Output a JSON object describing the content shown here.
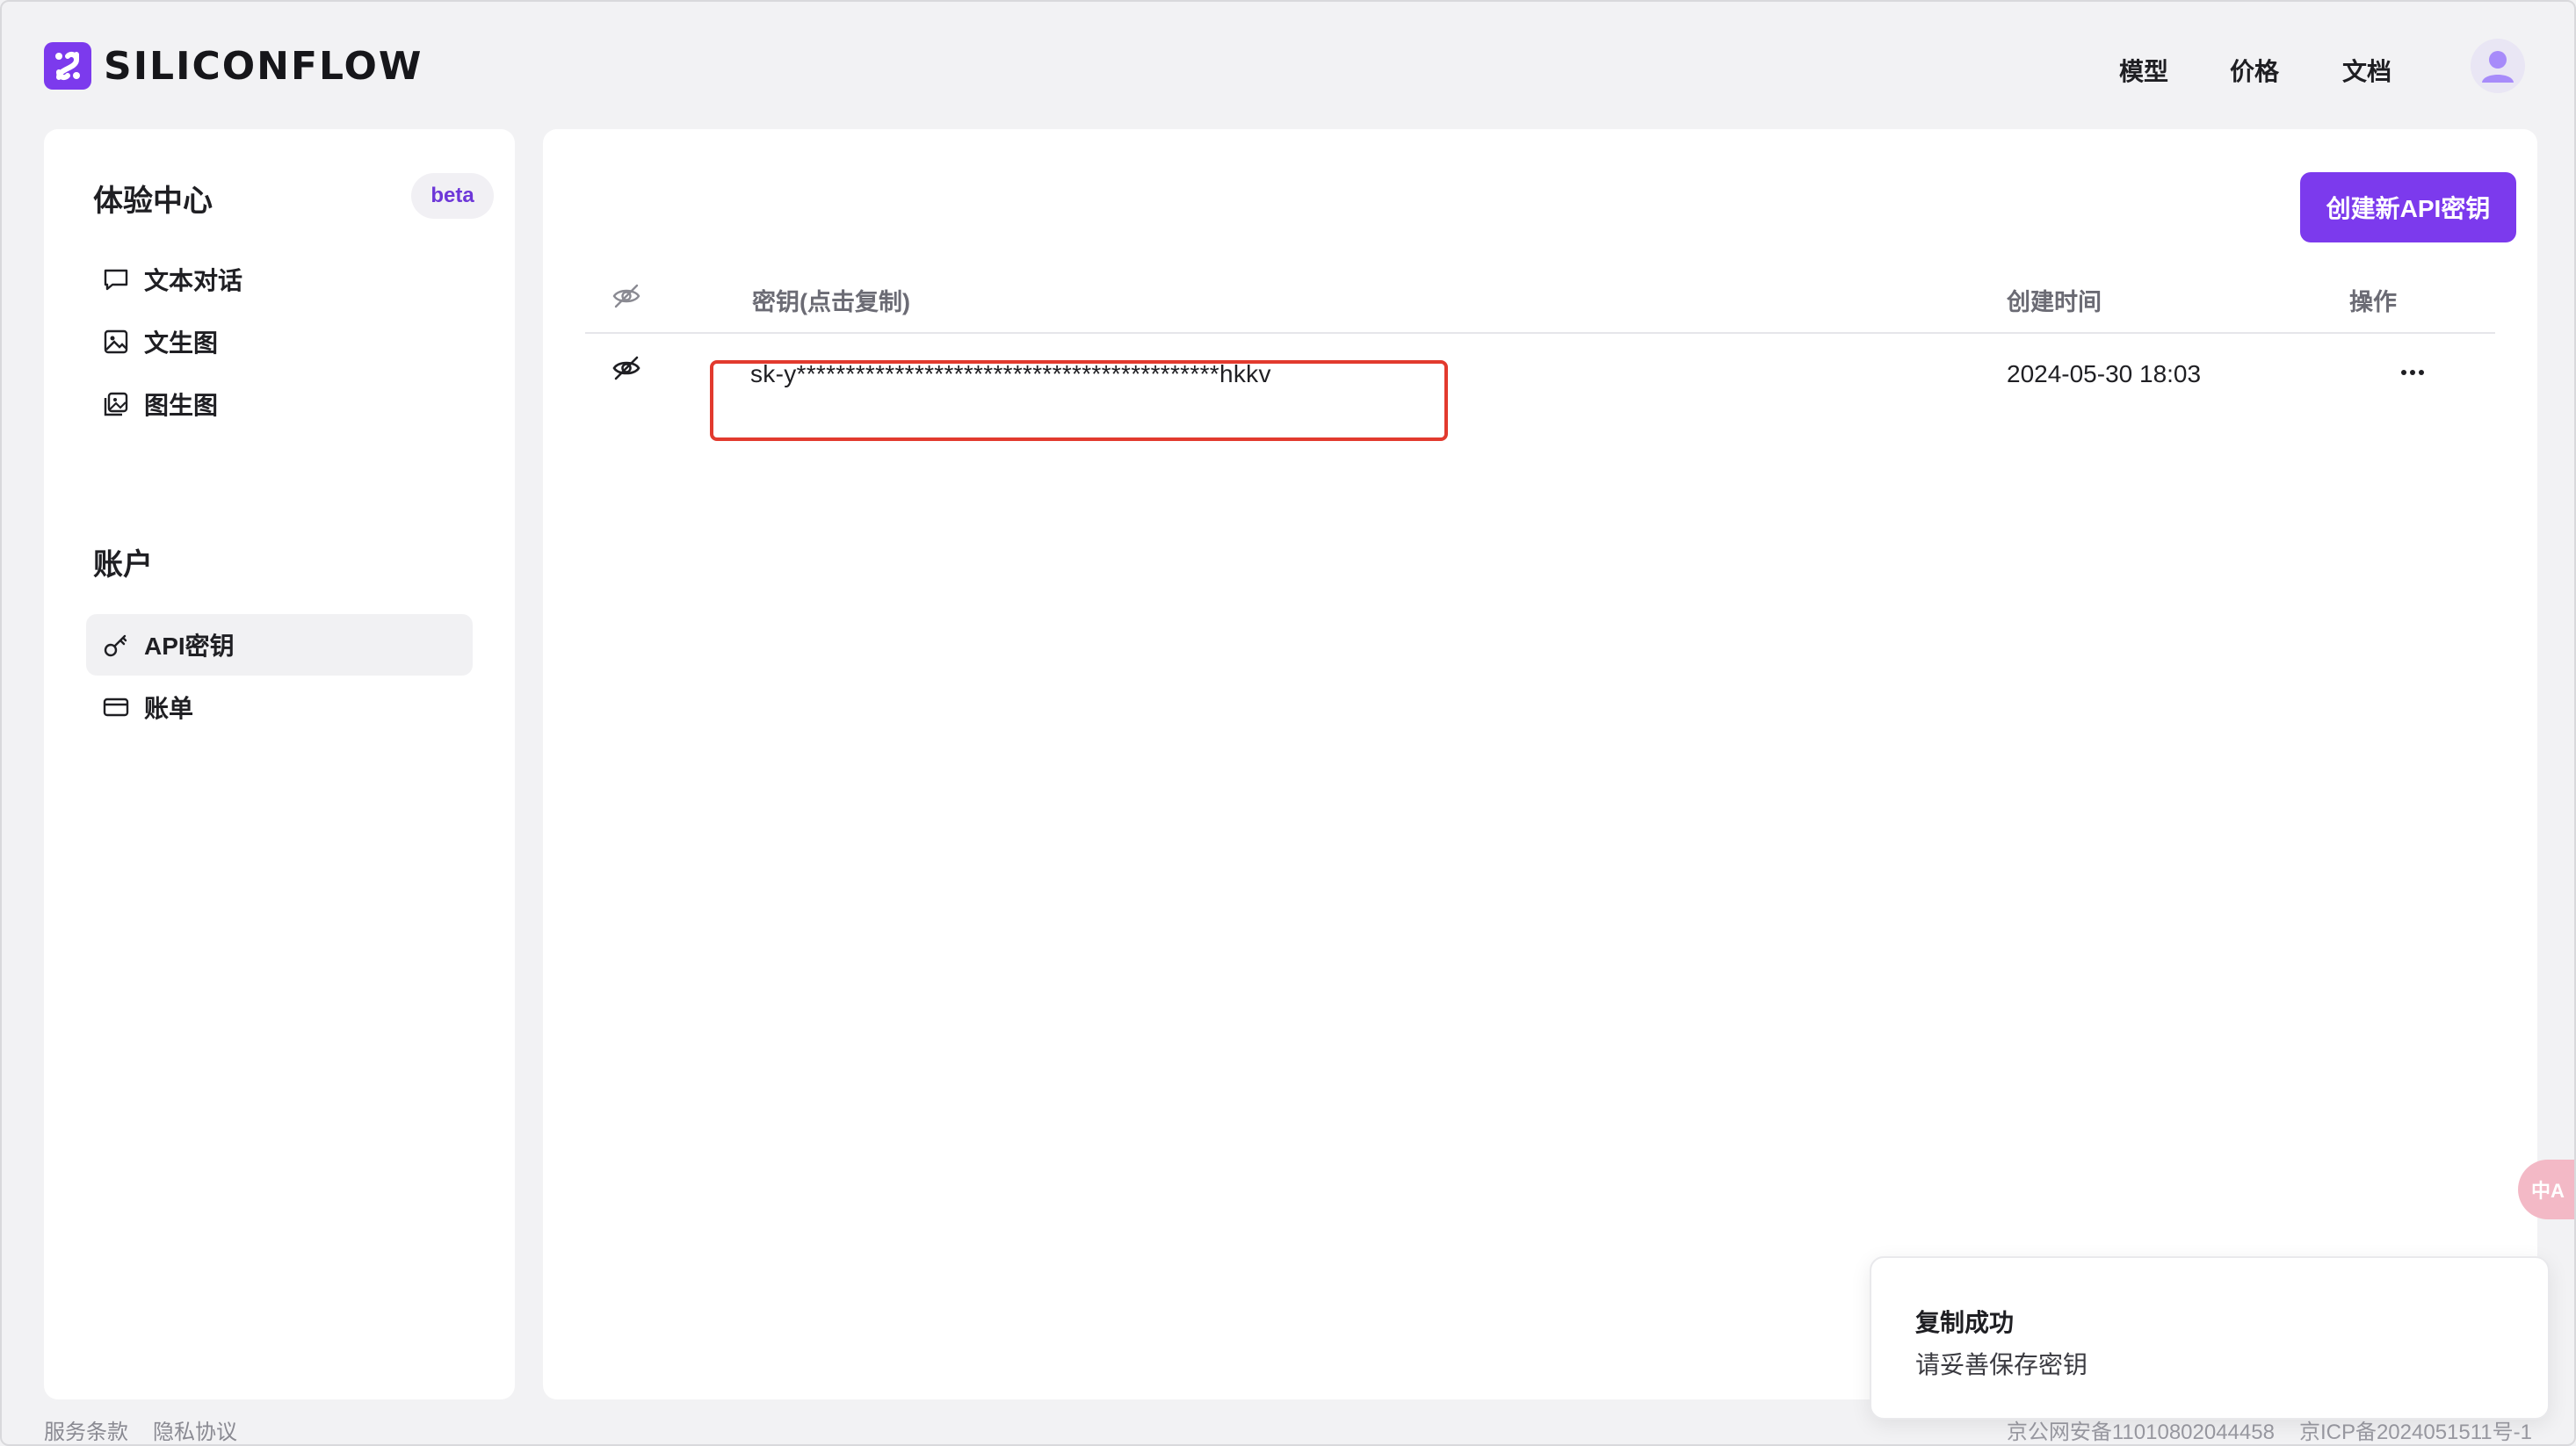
{
  "brand": {
    "name": "SILICONFLOW",
    "accent": "#7c3aed"
  },
  "nav": {
    "models": "模型",
    "pricing": "价格",
    "docs": "文档"
  },
  "sidebar": {
    "experience_heading": "体验中心",
    "beta_badge": "beta",
    "experience_items": [
      {
        "label": "文本对话",
        "icon": "chat-icon"
      },
      {
        "label": "文生图",
        "icon": "image-icon"
      },
      {
        "label": "图生图",
        "icon": "image-stack-icon"
      }
    ],
    "account_heading": "账户",
    "account_items": [
      {
        "label": "API密钥",
        "icon": "key-icon",
        "active": true
      },
      {
        "label": "账单",
        "icon": "card-icon",
        "active": false
      }
    ]
  },
  "main": {
    "create_button": "创建新API密钥",
    "table": {
      "col_key": "密钥(点击复制)",
      "col_created": "创建时间",
      "col_actions": "操作",
      "rows": [
        {
          "key": "sk-y*******************************************hkkv",
          "created": "2024-05-30 18:03"
        }
      ]
    }
  },
  "footer": {
    "terms": "服务条款",
    "privacy": "隐私协议",
    "police_record": "京公网安备11010802044458",
    "icp_record": "京ICP备2024051511号-1"
  },
  "toast": {
    "title": "复制成功",
    "message": "请妥善保存密钥"
  },
  "translate_fab": {
    "label": "中A"
  }
}
